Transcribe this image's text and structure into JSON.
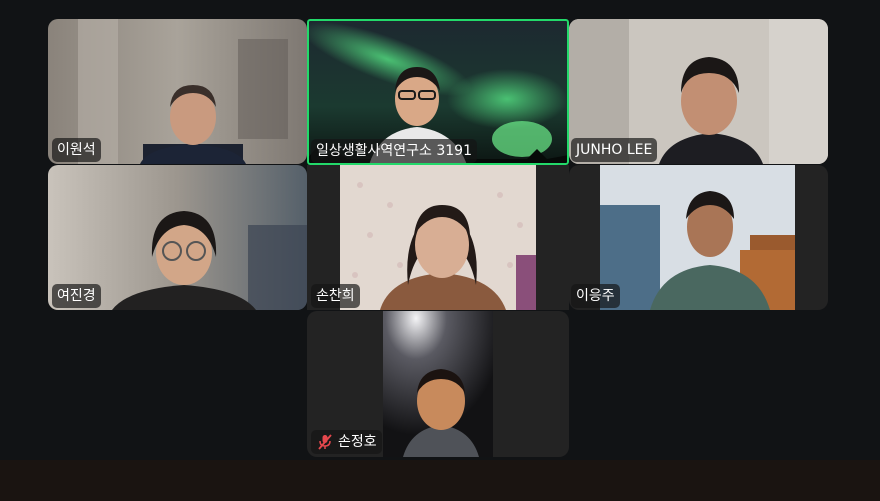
{
  "participants": [
    {
      "name": "이원석",
      "muted": false,
      "active_speaker": false
    },
    {
      "name": "일상생활사역연구소 3191",
      "muted": false,
      "active_speaker": true
    },
    {
      "name": "JUNHO LEE",
      "muted": false,
      "active_speaker": false
    },
    {
      "name": "여진경",
      "muted": false,
      "active_speaker": false
    },
    {
      "name": "손찬희",
      "muted": false,
      "active_speaker": false
    },
    {
      "name": "이응주",
      "muted": false,
      "active_speaker": false
    },
    {
      "name": "손정호",
      "muted": true,
      "active_speaker": false
    }
  ],
  "colors": {
    "background": "#111315",
    "tile": "#232323",
    "active_speaker_border": "#23d96a",
    "mute_icon": "#e5484d",
    "bottom_bar": "#1a1411"
  },
  "icons": {
    "mute": "microphone-muted-icon"
  }
}
